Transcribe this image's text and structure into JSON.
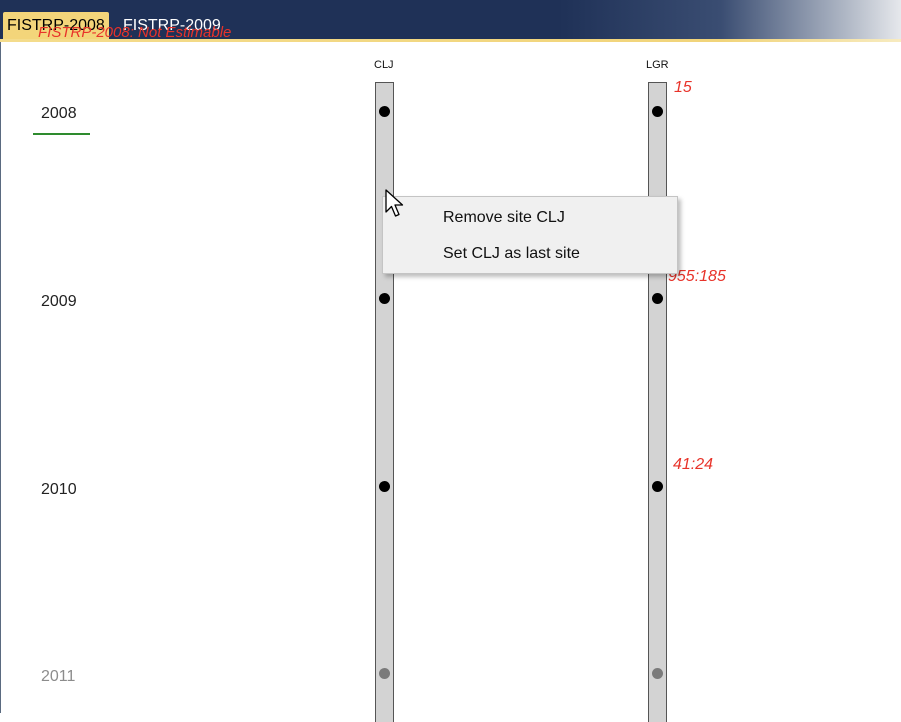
{
  "tabs": [
    {
      "label": "FISTRP-2008",
      "active": true
    },
    {
      "label": "FISTRP-2009",
      "active": false
    }
  ],
  "banner": "FISTRP-2008: Not Estimable",
  "years": [
    "2008",
    "2009",
    "2010",
    "2011"
  ],
  "selected_year": "2008",
  "sites": [
    {
      "label": "CLJ"
    },
    {
      "label": "LGR"
    }
  ],
  "counts": [
    "15",
    "955:185",
    "41:24"
  ],
  "context_menu": {
    "items": [
      "Remove site CLJ",
      "Set CLJ as last site"
    ]
  },
  "colors": {
    "accent": "#f3d57a",
    "tabbar": "#1f3157",
    "count_text": "#e8332a",
    "selection_underline": "#2e8b2e",
    "track": "#d3d3d3"
  },
  "icons": [
    "mouse-pointer-icon"
  ]
}
